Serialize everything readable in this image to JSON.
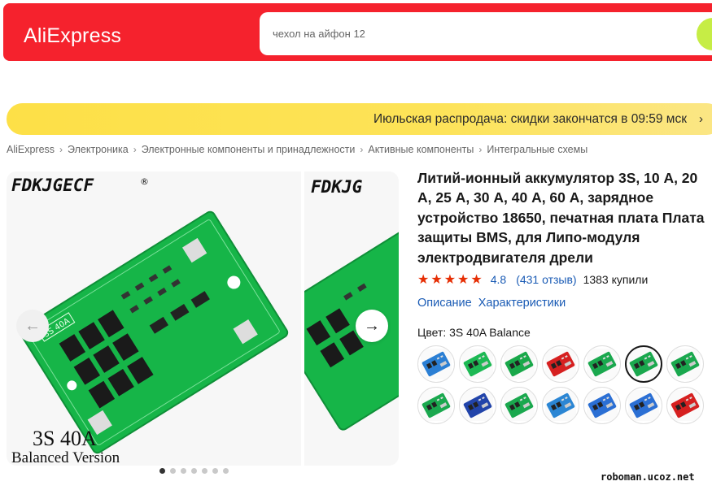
{
  "header": {
    "logo": "AliExpress",
    "search_placeholder": "чехол на айфон 12",
    "brand_color": "#f5222d",
    "search_button_color": "#c6ed45"
  },
  "promo": {
    "text": "Июльская распродача: скидки закончатся в 09:59 мск",
    "chevron": "›"
  },
  "breadcrumb": [
    "AliExpress",
    "Электроника",
    "Электронные компоненты и принадлежности",
    "Активные компоненты",
    "Интегральные схемы"
  ],
  "gallery": {
    "brand_text": "FDKJGECF",
    "brand_text_partial": "FDKJG",
    "board_label": "3S 40A",
    "caption_main": "3S 40A",
    "caption_sub": "Balanced Version",
    "prev_icon": "arrow-left-icon",
    "next_icon": "arrow-right-icon",
    "dot_count": 7,
    "active_dot": 0
  },
  "product": {
    "title": "Литий-ионный аккумулятор 3S, 10 А, 20 А, 25 А, 30 А, 40 А, 60 А, зарядное устройство 18650, печатная плата Плата защиты BMS, для Липо-модуля электродвигателя дрели",
    "stars": "★★★★★",
    "rating": "4.8",
    "reviews": "(431 отзыв)",
    "sold": "1383 купили",
    "tabs": [
      "Описание",
      "Характеристики"
    ],
    "color_label": "Цвет: 3S 40A Balance",
    "star_color": "#e62e04",
    "link_color": "#1a5bb5"
  },
  "swatches": [
    {
      "name": "variant-1",
      "color": "#2b7fd4"
    },
    {
      "name": "variant-2",
      "color": "#1db954"
    },
    {
      "name": "variant-3",
      "color": "#19a84a"
    },
    {
      "name": "variant-4",
      "color": "#d62020"
    },
    {
      "name": "variant-5",
      "color": "#1aa84e"
    },
    {
      "name": "variant-6",
      "color": "#1aa84e",
      "selected": true
    },
    {
      "name": "variant-7",
      "color": "#1aa84e"
    },
    {
      "name": "variant-8",
      "color": "#1aa84e"
    },
    {
      "name": "variant-9",
      "color": "#2244aa"
    },
    {
      "name": "variant-10",
      "color": "#1aa84e"
    },
    {
      "name": "variant-11",
      "color": "#2b86d4"
    },
    {
      "name": "variant-12",
      "color": "#2b6fd4"
    },
    {
      "name": "variant-13",
      "color": "#2b6fd4"
    },
    {
      "name": "variant-14",
      "color": "#d62020"
    }
  ],
  "watermark": "roboman.ucoz.net"
}
